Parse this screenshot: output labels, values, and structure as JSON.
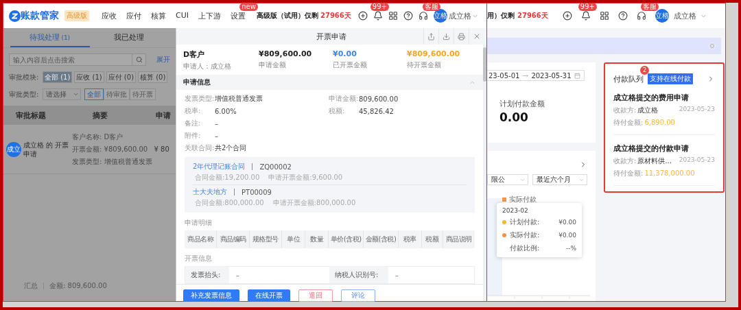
{
  "app_header": {
    "logo": "账款管家",
    "edition_badge": "高级版",
    "nav": [
      {
        "label": "应收"
      },
      {
        "label": "应付"
      },
      {
        "label": "核算"
      },
      {
        "label": "CUI"
      },
      {
        "label": "上下游"
      },
      {
        "label": "设置",
        "badge": "new"
      }
    ],
    "trial_label": "高级版（试用）仅剩",
    "trial_days": "27966天",
    "notification_badge": "99+",
    "service_badge": "客服",
    "avatar": "立格",
    "user": "成立格"
  },
  "approval_list": {
    "tabs": [
      {
        "label": "待我处理",
        "count": "(1)",
        "selected": true
      },
      {
        "label": "我已处理",
        "selected": false
      }
    ],
    "search": {
      "placeholder": "输入内容后点击搜索"
    },
    "expand_link": "展开",
    "module_filter": {
      "label": "审批模块:",
      "options": [
        {
          "label": "全部 (1)",
          "selected": true
        },
        {
          "label": "应收 (1)",
          "selected": false
        },
        {
          "label": "应付 (0)",
          "selected": false
        },
        {
          "label": "核算 (0)",
          "selected": false
        }
      ]
    },
    "type_filter": {
      "label": "审批类型:",
      "placeholder": "请选择",
      "options": [
        {
          "label": "全部",
          "selected": true
        },
        {
          "label": "待审批",
          "selected": false
        },
        {
          "label": "待开票",
          "selected": false
        }
      ]
    },
    "columns": [
      "审批标题",
      "摘要",
      "申请"
    ],
    "rows": [
      {
        "avatar": "成立",
        "title": "成立格 的 开票申请",
        "summary": [
          "客户名称: D客户",
          "开票金额: ¥809,600.00",
          "发票类型: 增值税普通发票"
        ],
        "amount": "¥ 80"
      }
    ],
    "total": {
      "label": "汇总",
      "amount": "金额: 809,600.00"
    }
  },
  "invoice_dialog": {
    "title": "开票申请",
    "customer": "D客户",
    "applicant": "申请人：成立格",
    "amounts": [
      {
        "value": "¥809,600.00",
        "label": "申请金额",
        "kind": "plain"
      },
      {
        "value": "¥0.00",
        "label": "已开票金额",
        "kind": "done"
      },
      {
        "value": "¥809,600.00",
        "label": "待开票金额",
        "kind": "pending"
      }
    ],
    "section": "申请信息",
    "field_rows": [
      [
        {
          "label": "发票类型:",
          "value": "增值税普通发票"
        },
        {
          "label": "申请金额:",
          "value": "809,600.00"
        }
      ],
      [
        {
          "label": "税率:",
          "value": "6.00%"
        },
        {
          "label": "税额:",
          "value": "45,826.42"
        }
      ],
      [
        {
          "label": "备注:",
          "value": "–"
        }
      ],
      [
        {
          "label": "附件:",
          "value": "–"
        }
      ],
      [
        {
          "label": "关联合同:",
          "value": "共2个合同"
        }
      ]
    ],
    "contracts": [
      {
        "name": "2年代理记账合同",
        "code": "ZQ00002",
        "amount": "合同金额:19,200.00",
        "invoice_amount": "申请开票金额:9,600.00"
      },
      {
        "name": "士大夫地方",
        "code": "PT00009",
        "amount": "合同金额:800,000.00",
        "invoice_amount": "申请开票金额:800,000.00"
      }
    ],
    "detail_title": "申请明细",
    "detail_columns": [
      "商品名称",
      "商品编码",
      "规格型号",
      "单位",
      "数量",
      "单价(含税)",
      "金额(含税)",
      "税率",
      "税额",
      "商品说明"
    ],
    "invoice_info_title": "开票信息",
    "invoice_info": [
      {
        "label": "发票抬头:",
        "value": "–"
      },
      {
        "label": "纳税人识别号:",
        "value": "–"
      }
    ],
    "buttons": [
      {
        "label": "补充发票信息",
        "kind": "primary"
      },
      {
        "label": "在线开票",
        "kind": "primary"
      },
      {
        "label": "退回",
        "kind": "danger"
      },
      {
        "label": "评论",
        "kind": "outline"
      }
    ]
  },
  "background_page": {
    "trial_label": "用）仅剩",
    "trial_days": "27966天",
    "notification_badge": "99+",
    "service_badge": "客服",
    "avatar": "立格",
    "user": "成立格",
    "date_from": "23-05-01",
    "date_to": "2023-05-31",
    "planned_label": "计划付款金额",
    "planned_value": "0.00",
    "selects": [
      "限公",
      "最近六个月"
    ],
    "legend": [
      {
        "label": "实际付款",
        "color": "#f0954a"
      }
    ],
    "tooltip": {
      "title": "2023-02",
      "rows": [
        {
          "label": "计划付款:",
          "value": "¥0.00",
          "color": "#f5b82e"
        },
        {
          "label": "实际付款:",
          "value": "¥0.00",
          "color": "#f0954a"
        },
        {
          "label": "付款比例:",
          "value": "--%"
        }
      ]
    },
    "queue": {
      "title": "付款队列",
      "count": "2",
      "tag": "支持在线付款",
      "items": [
        {
          "title": "成立格提交的费用申请",
          "payee_label": "收款方:",
          "payee": "成立格",
          "date": "2023-05-23",
          "due_label": "待付金额:",
          "due": "6,890.00"
        },
        {
          "title": "成立格提交的付款申请",
          "payee_label": "收款方:",
          "payee": "原材料供...",
          "date": "2023-05-23",
          "due_label": "待付金额:",
          "due": "11,378,000.00"
        }
      ]
    }
  }
}
